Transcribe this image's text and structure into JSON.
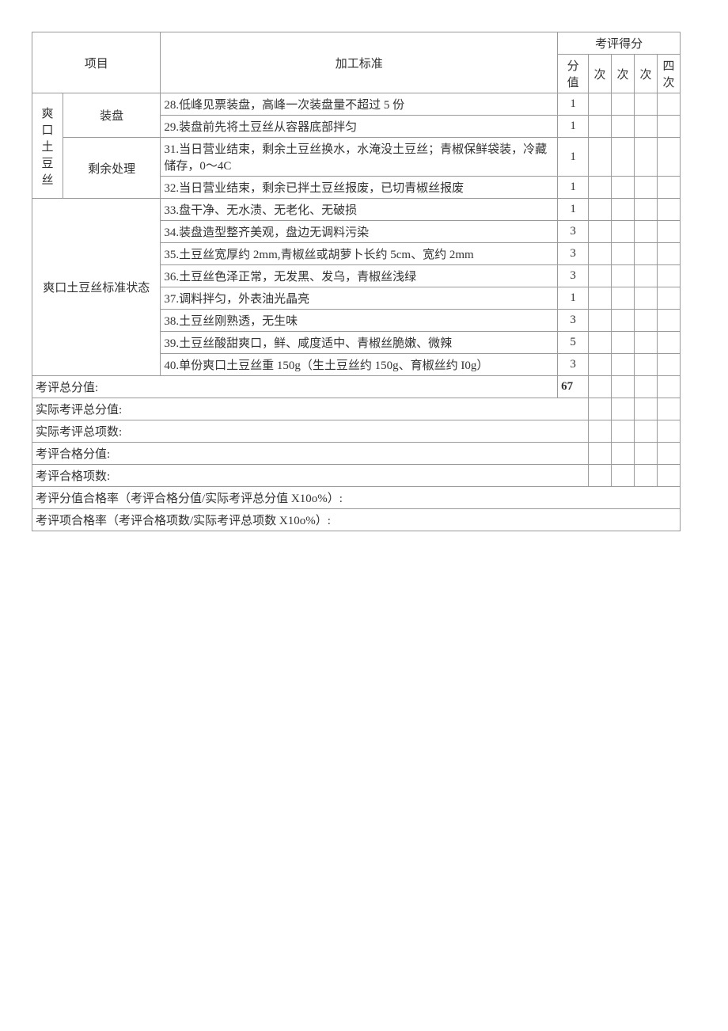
{
  "header": {
    "project_label": "项目",
    "standard_label": "加工标准",
    "score_group_label": "考评得分",
    "score_value_label": "分值",
    "round_suffix": "次",
    "round4_label": "四次"
  },
  "section1": {
    "group_label": "爽口土豆丝",
    "sub1_label": "装盘",
    "sub2_label": "剩余处理",
    "rows": [
      {
        "text": "28.低峰见票装盘，高峰一次装盘量不超过 5 份",
        "score": "1"
      },
      {
        "text": "29.装盘前先将土豆丝从容器底部拌匀",
        "score": "1"
      },
      {
        "text": "31.当日营业结束，剩余土豆丝换水，水淹没土豆丝；青椒保鲜袋装，冷藏储存，0～4C",
        "score": "1"
      },
      {
        "text": "32.当日营业结束，剩余已拌土豆丝报废，已切青椒丝报废",
        "score": "1"
      }
    ]
  },
  "section2": {
    "group_label": "爽口土豆丝标准状态",
    "rows": [
      {
        "text": "33.盘干净、无水渍、无老化、无破损",
        "score": "1"
      },
      {
        "text": "34.装盘造型整齐美观，盘边无调料污染",
        "score": "3"
      },
      {
        "text": "35.土豆丝宽厚约 2mm,青椒丝或胡萝卜长约 5cm、宽约 2mm",
        "score": "3"
      },
      {
        "text": "36.土豆丝色泽正常，无发黑、发乌，青椒丝浅绿",
        "score": "3"
      },
      {
        "text": "37.调料拌匀，外表油光晶亮",
        "score": "1"
      },
      {
        "text": "38.土豆丝刚熟透，无生味",
        "score": "3"
      },
      {
        "text": "39.土豆丝酸甜爽口，鲜、咸度适中、青椒丝脆嫩、微辣",
        "score": "5"
      },
      {
        "text": "40.单份爽口土豆丝重 150g（生土豆丝约 150g、育椒丝约 I0g）",
        "score": "3"
      }
    ]
  },
  "summary": {
    "total_label": "考评总分值:",
    "total_value": "67",
    "actual_total_score_label": "实际考评总分值:",
    "actual_total_items_label": "实际考评总项数:",
    "pass_score_label": "考评合格分值:",
    "pass_items_label": "考评合格项数:",
    "rate_score_label": "考评分值合格率（考评合格分值/实际考评总分值 X10o%）:",
    "rate_items_label": "考评项合格率（考评合格项数/实际考评总项数 X10o%）:"
  }
}
